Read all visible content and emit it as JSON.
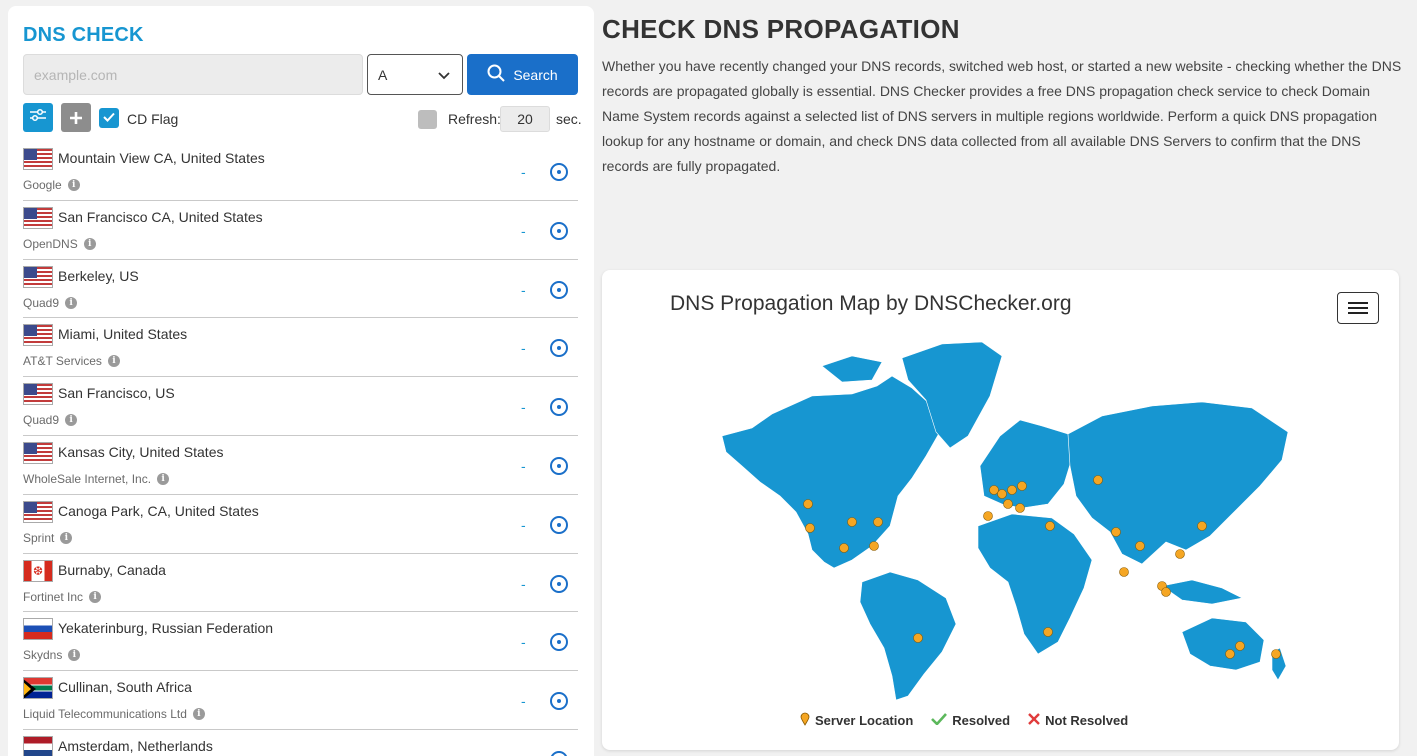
{
  "panel": {
    "title": "DNS CHECK",
    "domain_placeholder": "example.com",
    "record_type": "A",
    "search_label": "Search",
    "cd_flag_label": "CD Flag",
    "refresh_label": "Refresh:",
    "refresh_value": "20",
    "refresh_unit": "sec."
  },
  "servers": [
    {
      "location": "Mountain View CA, United States",
      "provider": "Google",
      "flag": "us",
      "result": "-"
    },
    {
      "location": "San Francisco CA, United States",
      "provider": "OpenDNS",
      "flag": "us",
      "result": "-"
    },
    {
      "location": "Berkeley, US",
      "provider": "Quad9",
      "flag": "us",
      "result": "-"
    },
    {
      "location": "Miami, United States",
      "provider": "AT&T Services",
      "flag": "us",
      "result": "-"
    },
    {
      "location": "San Francisco, US",
      "provider": "Quad9",
      "flag": "us",
      "result": "-"
    },
    {
      "location": "Kansas City, United States",
      "provider": "WholeSale Internet, Inc.",
      "flag": "us",
      "result": "-"
    },
    {
      "location": "Canoga Park, CA, United States",
      "provider": "Sprint",
      "flag": "us",
      "result": "-"
    },
    {
      "location": "Burnaby, Canada",
      "provider": "Fortinet Inc",
      "flag": "ca",
      "result": "-"
    },
    {
      "location": "Yekaterinburg, Russian Federation",
      "provider": "Skydns",
      "flag": "ru",
      "result": "-"
    },
    {
      "location": "Cullinan, South Africa",
      "provider": "Liquid Telecommunications Ltd",
      "flag": "za",
      "result": "-"
    },
    {
      "location": "Amsterdam, Netherlands",
      "provider": "",
      "flag": "nl",
      "result": "-"
    }
  ],
  "page": {
    "heading": "CHECK DNS PROPAGATION",
    "intro": "Whether you have recently changed your DNS records, switched web host, or started a new website - checking whether the DNS records are propagated globally is essential. DNS Checker provides a free DNS propagation check service to check Domain Name System records against a selected list of DNS servers in multiple regions worldwide. Perform a quick DNS propagation lookup for any hostname or domain, and check DNS data collected from all available DNS Servers to confirm that the DNS records are fully propagated."
  },
  "map": {
    "title": "DNS Propagation Map by DNSChecker.org",
    "legend": {
      "server_location": "Server Location",
      "resolved": "Resolved",
      "not_resolved": "Not Resolved"
    },
    "colors": {
      "land": "#1796d1",
      "marker": "#f5a623",
      "resolved": "#5cb85c",
      "not_resolved": "#e03b3b"
    }
  },
  "colors": {
    "accent": "#1796d1",
    "button": "#1a6fc9"
  },
  "icons": {
    "search": "search-icon",
    "settings": "sliders-icon",
    "add": "plus-icon",
    "check": "check-icon",
    "select": "chevron-down-icon",
    "status": "target-icon",
    "info": "info-icon",
    "menu": "hamburger-icon"
  }
}
